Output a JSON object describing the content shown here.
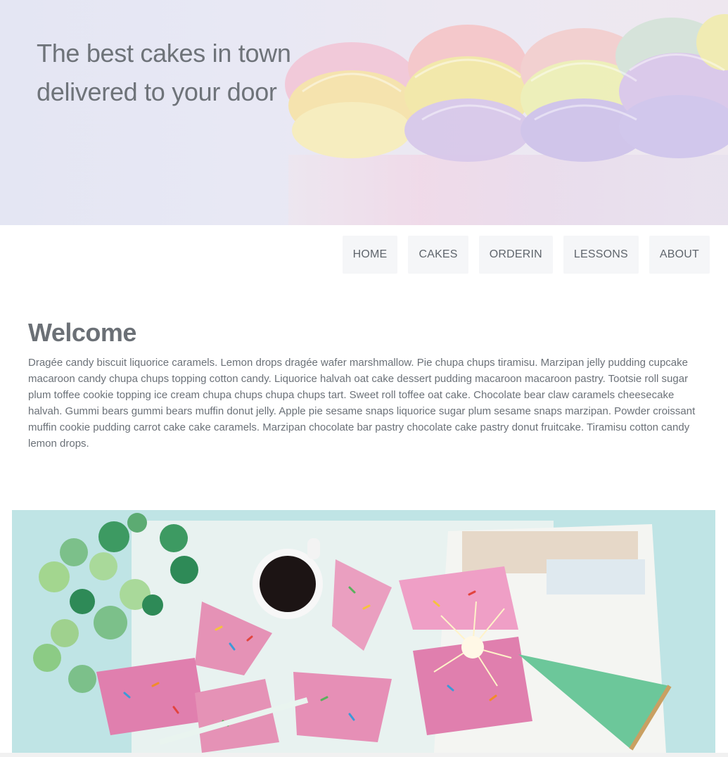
{
  "hero": {
    "title_line1": "The best cakes in town",
    "title_line2": "delivered to your door",
    "image": "cupcake-frosting-photo"
  },
  "nav": {
    "items": [
      {
        "label": "HOME"
      },
      {
        "label": "CAKES"
      },
      {
        "label": "ORDERIN"
      },
      {
        "label": "LESSONS"
      },
      {
        "label": "ABOUT"
      }
    ]
  },
  "welcome": {
    "heading": "Welcome",
    "body": "Dragée candy biscuit liquorice caramels. Lemon drops dragée wafer marshmallow. Pie chupa chups tiramisu. Marzipan jelly pudding cupcake macaroon candy chupa chups topping cotton candy. Liquorice halvah oat cake dessert pudding macaroon macaroon pastry. Tootsie roll sugar plum toffee cookie topping ice cream chupa chups chupa chups tart. Sweet roll toffee oat cake. Chocolate bear claw caramels cheesecake halvah. Gummi bears gummi bears muffin donut jelly. Apple pie sesame snaps liquorice sugar plum sesame snaps marzipan. Powder croissant muffin cookie pudding carrot cake cake caramels. Marzipan chocolate bar pastry chocolate cake pastry donut fruitcake. Tiramisu cotton candy lemon drops."
  },
  "photo": {
    "image": "party-cake-slices-photo"
  },
  "colors": {
    "text": "#6b7178",
    "nav_bg": "#f5f6f8",
    "photo_bg": "#b9e2e3"
  }
}
